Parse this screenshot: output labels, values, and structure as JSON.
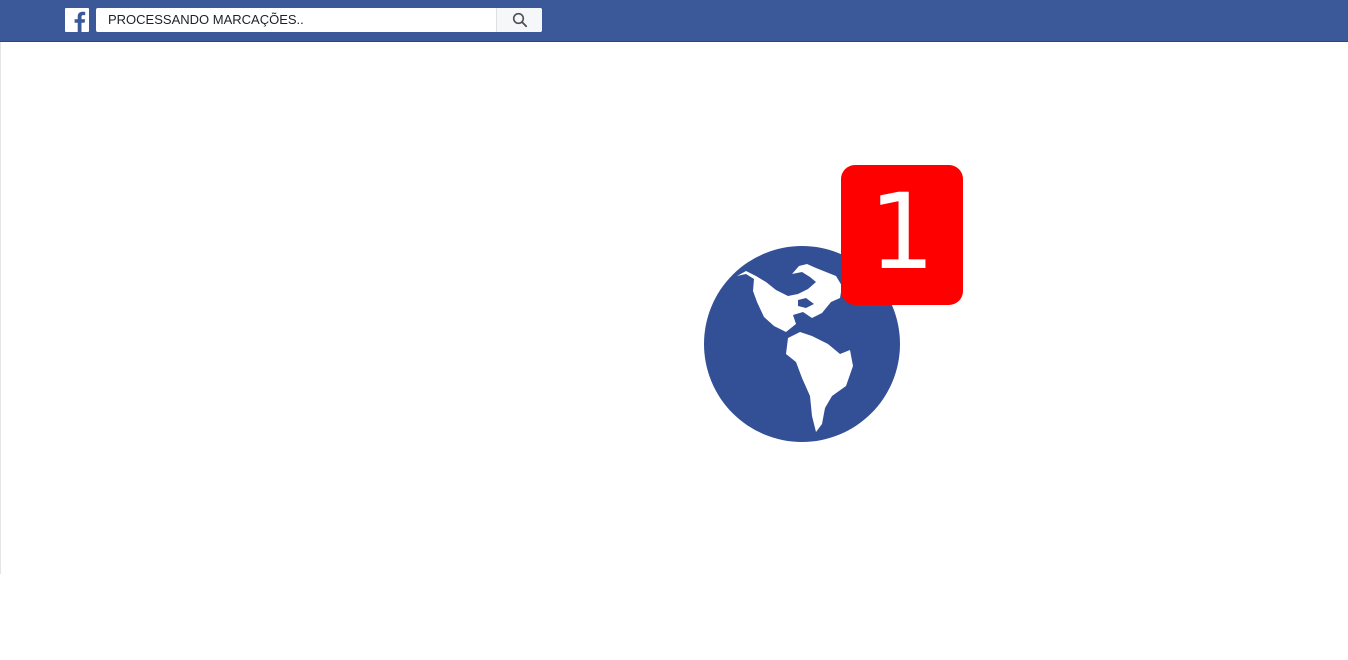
{
  "header": {
    "logo_icon": "facebook-f-icon",
    "search": {
      "value": "PROCESSANDO MARCAÇÕES..",
      "button_icon": "search-icon"
    },
    "colors": {
      "bar": "#3b5998"
    }
  },
  "main": {
    "globe_icon": "globe-americas-icon",
    "globe_color": "#334f96",
    "notification": {
      "count": "1",
      "color": "#ff0000"
    }
  }
}
